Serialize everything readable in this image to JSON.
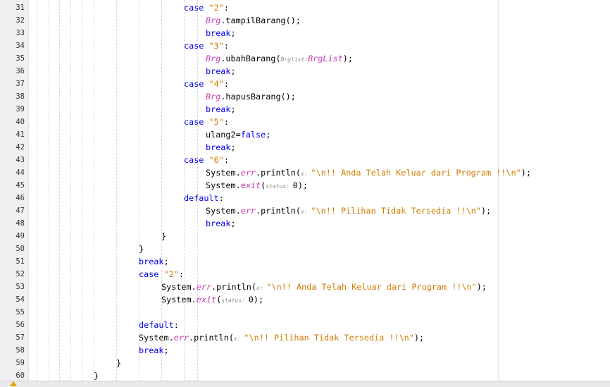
{
  "editor": {
    "lines": [
      {
        "num": "31",
        "tokens": [
          {
            "t": "case ",
            "c": "kw"
          },
          {
            "t": "\"2\"",
            "c": "str"
          },
          {
            "t": ":",
            "c": ""
          }
        ]
      },
      {
        "num": "32",
        "tokens": [
          {
            "t": "Brg",
            "c": "var"
          },
          {
            "t": ".tampilBarang();",
            "c": ""
          }
        ]
      },
      {
        "num": "33",
        "tokens": [
          {
            "t": "break",
            "c": "kw"
          },
          {
            "t": ";",
            "c": ""
          }
        ]
      },
      {
        "num": "34",
        "tokens": [
          {
            "t": "case ",
            "c": "kw"
          },
          {
            "t": "\"3\"",
            "c": "str"
          },
          {
            "t": ":",
            "c": ""
          }
        ]
      },
      {
        "num": "35",
        "tokens": [
          {
            "t": "Brg",
            "c": "var"
          },
          {
            "t": ".ubahBarang(",
            "c": ""
          },
          {
            "t": "Brglist:",
            "c": "hint"
          },
          {
            "t": "BrgList",
            "c": "var"
          },
          {
            "t": ");",
            "c": ""
          }
        ]
      },
      {
        "num": "36",
        "tokens": [
          {
            "t": "break",
            "c": "kw"
          },
          {
            "t": ";",
            "c": ""
          }
        ]
      },
      {
        "num": "37",
        "tokens": [
          {
            "t": "case ",
            "c": "kw"
          },
          {
            "t": "\"4\"",
            "c": "str"
          },
          {
            "t": ":",
            "c": ""
          }
        ]
      },
      {
        "num": "38",
        "tokens": [
          {
            "t": "Brg",
            "c": "var"
          },
          {
            "t": ".hapusBarang();",
            "c": ""
          }
        ]
      },
      {
        "num": "39",
        "tokens": [
          {
            "t": "break",
            "c": "kw"
          },
          {
            "t": ";",
            "c": ""
          }
        ]
      },
      {
        "num": "40",
        "tokens": [
          {
            "t": "case ",
            "c": "kw"
          },
          {
            "t": "\"5\"",
            "c": "str"
          },
          {
            "t": ":",
            "c": ""
          }
        ]
      },
      {
        "num": "41",
        "tokens": [
          {
            "t": "ulang2=",
            "c": ""
          },
          {
            "t": "false",
            "c": "kw"
          },
          {
            "t": ";",
            "c": ""
          }
        ]
      },
      {
        "num": "42",
        "tokens": [
          {
            "t": "break",
            "c": "kw"
          },
          {
            "t": ";",
            "c": ""
          }
        ]
      },
      {
        "num": "43",
        "tokens": [
          {
            "t": "case ",
            "c": "kw"
          },
          {
            "t": "\"6\"",
            "c": "str"
          },
          {
            "t": ":",
            "c": ""
          }
        ]
      },
      {
        "num": "44",
        "tokens": [
          {
            "t": "System.",
            "c": ""
          },
          {
            "t": "err",
            "c": "var"
          },
          {
            "t": ".println(",
            "c": ""
          },
          {
            "t": "x: ",
            "c": "hint"
          },
          {
            "t": "\"\\n!! Anda Telah Keluar dari Program !!\\n\"",
            "c": "str"
          },
          {
            "t": ");",
            "c": ""
          }
        ]
      },
      {
        "num": "45",
        "tokens": [
          {
            "t": "System.",
            "c": ""
          },
          {
            "t": "exit",
            "c": "var"
          },
          {
            "t": "(",
            "c": ""
          },
          {
            "t": "status: ",
            "c": "hint"
          },
          {
            "t": "0);",
            "c": ""
          }
        ]
      },
      {
        "num": "46",
        "tokens": [
          {
            "t": "default",
            "c": "kw"
          },
          {
            "t": ":",
            "c": ""
          }
        ]
      },
      {
        "num": "47",
        "tokens": [
          {
            "t": "System.",
            "c": ""
          },
          {
            "t": "err",
            "c": "var"
          },
          {
            "t": ".println(",
            "c": ""
          },
          {
            "t": "x: ",
            "c": "hint"
          },
          {
            "t": "\"\\n!! Pilihan Tidak Tersedia !!\\n\"",
            "c": "str"
          },
          {
            "t": ");",
            "c": ""
          }
        ]
      },
      {
        "num": "48",
        "tokens": [
          {
            "t": "break",
            "c": "kw"
          },
          {
            "t": ";",
            "c": ""
          }
        ]
      },
      {
        "num": "49",
        "tokens": [
          {
            "t": "}",
            "c": ""
          }
        ]
      },
      {
        "num": "50",
        "tokens": [
          {
            "t": "}",
            "c": ""
          }
        ]
      },
      {
        "num": "51",
        "tokens": [
          {
            "t": "break",
            "c": "kw"
          },
          {
            "t": ";",
            "c": ""
          }
        ]
      },
      {
        "num": "52",
        "tokens": [
          {
            "t": "case ",
            "c": "kw"
          },
          {
            "t": "\"2\"",
            "c": "str"
          },
          {
            "t": ":",
            "c": ""
          }
        ]
      },
      {
        "num": "53",
        "tokens": [
          {
            "t": "System.",
            "c": ""
          },
          {
            "t": "err",
            "c": "var"
          },
          {
            "t": ".println(",
            "c": ""
          },
          {
            "t": "x: ",
            "c": "hint"
          },
          {
            "t": "\"\\n!! Anda Telah Keluar dari Program !!\\n\"",
            "c": "str"
          },
          {
            "t": ");",
            "c": ""
          }
        ]
      },
      {
        "num": "54",
        "tokens": [
          {
            "t": "System.",
            "c": ""
          },
          {
            "t": "exit",
            "c": "var"
          },
          {
            "t": "(",
            "c": ""
          },
          {
            "t": "status: ",
            "c": "hint"
          },
          {
            "t": "0);",
            "c": ""
          }
        ]
      },
      {
        "num": "55",
        "tokens": []
      },
      {
        "num": "56",
        "tokens": [
          {
            "t": "default",
            "c": "kw"
          },
          {
            "t": ":",
            "c": ""
          }
        ]
      },
      {
        "num": "57",
        "tokens": [
          {
            "t": "System.",
            "c": ""
          },
          {
            "t": "err",
            "c": "var"
          },
          {
            "t": ".println(",
            "c": ""
          },
          {
            "t": "x: ",
            "c": "hint"
          },
          {
            "t": "\"\\n!! Pilihan Tidak Tersedia !!\\n\"",
            "c": "str"
          },
          {
            "t": ");",
            "c": ""
          }
        ]
      },
      {
        "num": "58",
        "tokens": [
          {
            "t": "break",
            "c": "kw"
          },
          {
            "t": ";",
            "c": ""
          }
        ]
      },
      {
        "num": "59",
        "tokens": [
          {
            "t": "}",
            "c": ""
          }
        ]
      },
      {
        "num": "60",
        "tokens": [
          {
            "t": "}",
            "c": ""
          }
        ]
      }
    ]
  },
  "status_bar": {
    "icon": "warning-icon"
  },
  "colors": {
    "keyword": "#0000e6",
    "string": "#ce7b00",
    "field": "#c53db3",
    "hint": "#888888"
  }
}
